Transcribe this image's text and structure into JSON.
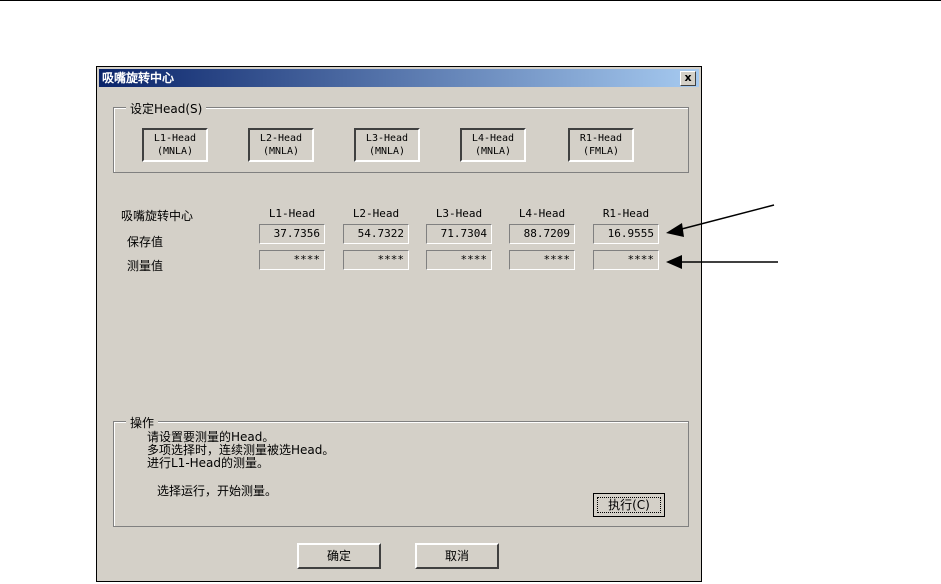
{
  "window": {
    "title": "吸嘴旋转中心",
    "close_label": "x"
  },
  "head_group": {
    "label": "设定Head(S)",
    "heads": [
      {
        "line1": "L1-Head",
        "line2": "(MNLA)"
      },
      {
        "line1": "L2-Head",
        "line2": "(MNLA)"
      },
      {
        "line1": "L3-Head",
        "line2": "(MNLA)"
      },
      {
        "line1": "L4-Head",
        "line2": "(MNLA)"
      },
      {
        "line1": "R1-Head",
        "line2": "(FMLA)"
      }
    ]
  },
  "table": {
    "section_label": "吸嘴旋转中心",
    "columns": [
      "L1-Head",
      "L2-Head",
      "L3-Head",
      "L4-Head",
      "R1-Head"
    ],
    "rows": [
      {
        "label": "保存值",
        "values": [
          "37.7356",
          "54.7322",
          "71.7304",
          "88.7209",
          "16.9555"
        ]
      },
      {
        "label": "测量值",
        "values": [
          "****",
          "****",
          "****",
          "****",
          "****"
        ]
      }
    ]
  },
  "operation": {
    "label": "操作",
    "lines": [
      "请设置要测量的Head。",
      "多项选择时，连续测量被选Head。",
      "进行L1-Head的测量。"
    ],
    "run_hint": "选择运行，开始测量。",
    "execute_label": "执行(C)"
  },
  "buttons": {
    "ok": "确定",
    "cancel": "取消"
  },
  "colors": {
    "dialog_bg": "#d4d0c8",
    "title_start": "#0a246a",
    "title_end": "#a6caf0"
  }
}
